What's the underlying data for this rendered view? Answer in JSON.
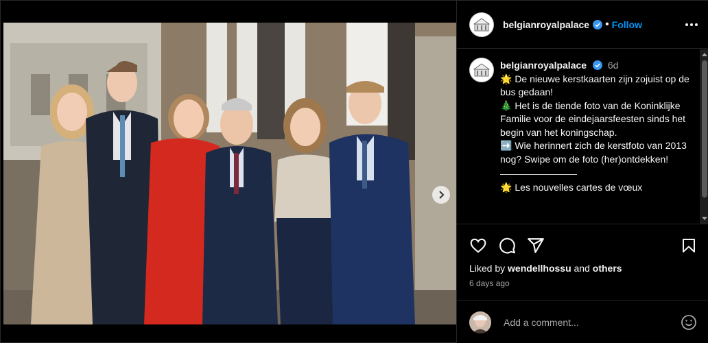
{
  "post": {
    "username": "belgianroyalpalace",
    "follow_label": "Follow",
    "separator": "•",
    "caption": {
      "time": "6d",
      "lines": [
        "🌟 De nieuwe kerstkaarten zijn zojuist op de bus gedaan!",
        "🎄 Het is de tiende foto van de Koninklijke Familie voor de eindejaarsfeesten sinds het begin van het koningschap.",
        "➡️ Wie herinnert zich de kerstfoto van 2013 nog? Swipe om de foto (her)ontdekken!",
        "————————",
        "🌟 Les nouvelles cartes de vœux"
      ]
    },
    "liked_by_prefix": "Liked by",
    "liked_by_user": "wendellhossu",
    "liked_by_and": "and",
    "liked_by_others": "others",
    "time_ago": "6 days ago",
    "comment_placeholder": "Add a comment...",
    "carousel": {
      "current": 1,
      "total": 2
    }
  },
  "colors": {
    "accent": "#0095f6",
    "verified": "#3897f0",
    "background": "#000000",
    "muted": "#a8a8a8"
  },
  "icons": {
    "header_more": "more-horizontal-icon",
    "like": "heart-icon",
    "comment": "comment-icon",
    "share": "send-icon",
    "save": "bookmark-icon",
    "emoji": "emoji-icon",
    "next": "chevron-right-icon",
    "verified": "verified-badge-icon"
  }
}
